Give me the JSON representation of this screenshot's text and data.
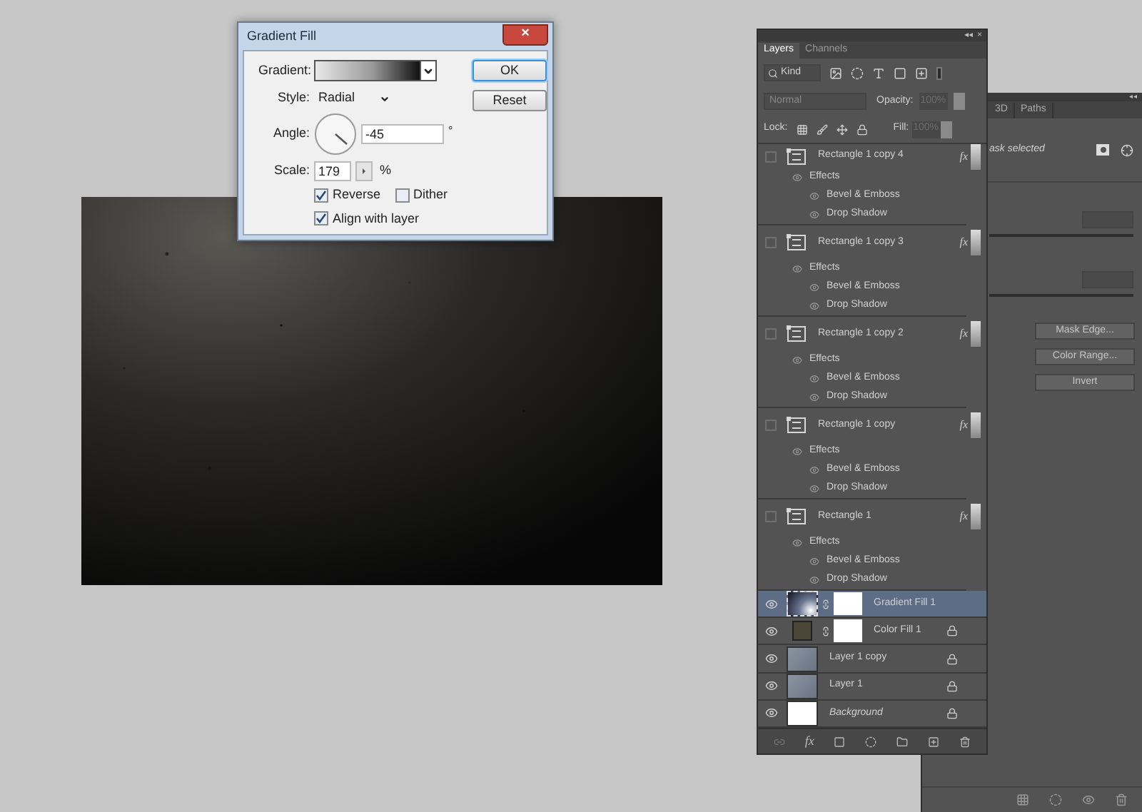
{
  "dialog": {
    "title": "Gradient Fill",
    "close": "×",
    "gradient": {
      "label": "Gradient:"
    },
    "style": {
      "label": "Style:",
      "value": "Radial"
    },
    "angle": {
      "label": "Angle:",
      "value": "-45",
      "unit": "°"
    },
    "scale": {
      "label": "Scale:",
      "value": "179",
      "unit": "%"
    },
    "checkboxes": [
      {
        "label": "Reverse",
        "checked": true
      },
      {
        "label": "Dither",
        "checked": false
      },
      {
        "label": "Align with layer",
        "checked": true
      }
    ],
    "buttons": [
      {
        "label": "OK",
        "selected": true
      },
      {
        "label": "Reset",
        "selected": false
      }
    ]
  },
  "layers_panel": {
    "collapse": "◂◂",
    "close": "×",
    "tabs": [
      {
        "label": "Layers",
        "selected": true
      },
      {
        "label": "Channels",
        "selected": false
      }
    ],
    "filter": {
      "value": "Kind"
    },
    "blend": {
      "value": "Normal",
      "opacity_label": "Opacity:",
      "opacity": "100%"
    },
    "lock": {
      "label": "Lock:",
      "fill_label": "Fill:",
      "fill": "100%"
    },
    "layers": [
      {
        "kind": "shape",
        "name": "Rectangle 1 copy 4",
        "visible": false,
        "selected": false,
        "fx": "fx",
        "effects": {
          "label": "Effects",
          "items": [
            "Bevel & Emboss",
            "Drop Shadow"
          ]
        }
      },
      {
        "kind": "shape",
        "name": "Rectangle 1 copy 3",
        "visible": false,
        "selected": false,
        "fx": "fx",
        "effects": {
          "label": "Effects",
          "items": [
            "Bevel & Emboss",
            "Drop Shadow"
          ]
        }
      },
      {
        "kind": "shape",
        "name": "Rectangle 1 copy 2",
        "visible": false,
        "selected": false,
        "fx": "fx",
        "effects": {
          "label": "Effects",
          "items": [
            "Bevel & Emboss",
            "Drop Shadow"
          ]
        }
      },
      {
        "kind": "shape",
        "name": "Rectangle 1 copy",
        "visible": false,
        "selected": false,
        "fx": "fx",
        "effects": {
          "label": "Effects",
          "items": [
            "Bevel & Emboss",
            "Drop Shadow"
          ]
        }
      },
      {
        "kind": "shape",
        "name": "Rectangle 1",
        "visible": false,
        "selected": false,
        "fx": "fx",
        "effects": {
          "label": "Effects",
          "items": [
            "Bevel & Emboss",
            "Drop Shadow"
          ]
        }
      },
      {
        "kind": "gradient",
        "name": "Gradient Fill 1",
        "visible": true,
        "selected": true,
        "locked": false
      },
      {
        "kind": "color",
        "name": "Color Fill 1",
        "visible": true,
        "selected": false,
        "locked": true
      },
      {
        "kind": "pixel",
        "name": "Layer 1 copy",
        "visible": true,
        "selected": false,
        "locked": true
      },
      {
        "kind": "pixel",
        "name": "Layer 1",
        "visible": true,
        "selected": false,
        "locked": true
      },
      {
        "kind": "background",
        "name": "Background",
        "visible": true,
        "selected": false,
        "locked": true
      }
    ],
    "footer": {
      "fx": "fx"
    }
  },
  "properties_panel": {
    "collapse": "◂◂",
    "tabs": [
      {
        "label": "3D",
        "selected": false
      },
      {
        "label": "Paths",
        "selected": false
      }
    ],
    "status": "ask selected",
    "buttons": [
      "Mask Edge...",
      "Color Range...",
      "Invert"
    ]
  }
}
